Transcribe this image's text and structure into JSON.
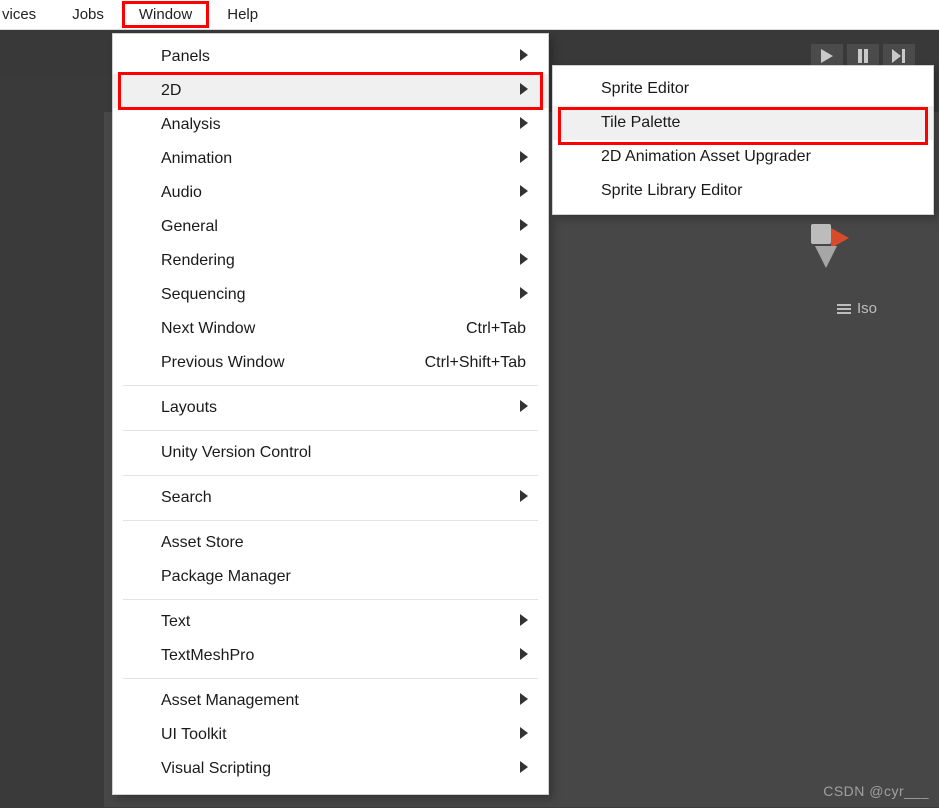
{
  "menubar": {
    "items": [
      {
        "label": "vices",
        "partial": true
      },
      {
        "label": "Jobs"
      },
      {
        "label": "Window",
        "highlighted": true
      },
      {
        "label": "Help"
      }
    ]
  },
  "toolbar": {
    "play_icon": "play-icon",
    "pause_icon": "pause-icon",
    "step_icon": "step-icon"
  },
  "window_menu": {
    "items": [
      {
        "label": "Panels",
        "submenu": true
      },
      {
        "label": "2D",
        "submenu": true,
        "hover": true,
        "highlight_red": true
      },
      {
        "label": "Analysis",
        "submenu": true
      },
      {
        "label": "Animation",
        "submenu": true
      },
      {
        "label": "Audio",
        "submenu": true
      },
      {
        "label": "General",
        "submenu": true
      },
      {
        "label": "Rendering",
        "submenu": true
      },
      {
        "label": "Sequencing",
        "submenu": true
      },
      {
        "label": "Next Window",
        "shortcut": "Ctrl+Tab"
      },
      {
        "label": "Previous Window",
        "shortcut": "Ctrl+Shift+Tab"
      }
    ],
    "group2": [
      {
        "label": "Layouts",
        "submenu": true
      }
    ],
    "group3": [
      {
        "label": "Unity Version Control"
      }
    ],
    "group4": [
      {
        "label": "Search",
        "submenu": true
      }
    ],
    "group5": [
      {
        "label": "Asset Store"
      },
      {
        "label": "Package Manager"
      }
    ],
    "group6": [
      {
        "label": "Text",
        "submenu": true
      },
      {
        "label": "TextMeshPro",
        "submenu": true
      }
    ],
    "group7": [
      {
        "label": "Asset Management",
        "submenu": true
      },
      {
        "label": "UI Toolkit",
        "submenu": true
      },
      {
        "label": "Visual Scripting",
        "submenu": true
      }
    ]
  },
  "submenu_2d": {
    "items": [
      {
        "label": "Sprite Editor"
      },
      {
        "label": "Tile Palette",
        "hover": true,
        "highlight_red": true
      },
      {
        "label": "2D Animation Asset Upgrader"
      },
      {
        "label": "Sprite Library Editor"
      }
    ]
  },
  "scene": {
    "iso_label": "Iso"
  },
  "watermark": "CSDN @cyr___"
}
